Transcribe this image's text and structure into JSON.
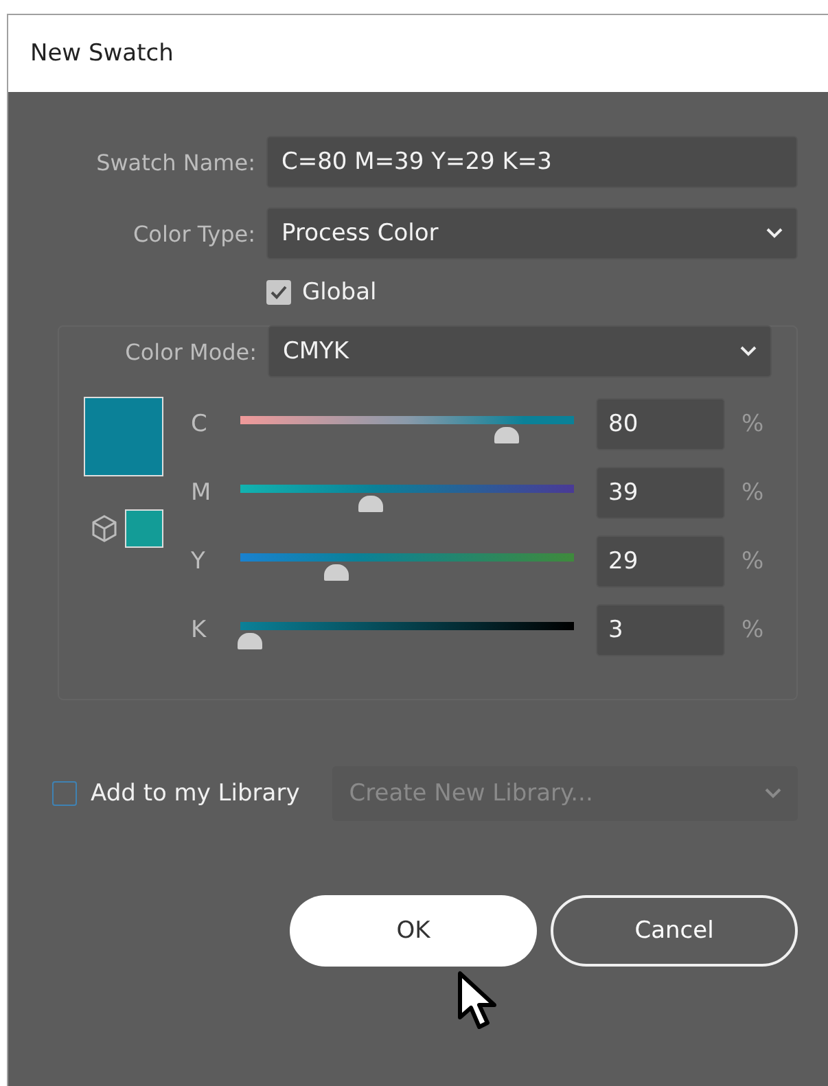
{
  "window": {
    "title": "New Swatch"
  },
  "swatch_name": {
    "label": "Swatch Name:",
    "value": "C=80 M=39 Y=29 K=3"
  },
  "color_type": {
    "label": "Color Type:",
    "value": "Process Color"
  },
  "global": {
    "label": "Global",
    "checked": true
  },
  "color_mode": {
    "label": "Color Mode:",
    "value": "CMYK"
  },
  "preview": {
    "swatch": {
      "color": "#0b8198"
    },
    "gamut_warning": {
      "color": "#139c97"
    }
  },
  "channels": [
    {
      "name": "C",
      "level": 0.8,
      "value": "80",
      "unit": "%"
    },
    {
      "name": "M",
      "level": 0.39,
      "value": "39",
      "unit": "%"
    },
    {
      "name": "Y",
      "level": 0.29,
      "value": "29",
      "unit": "%"
    },
    {
      "name": "K",
      "level": 0.03,
      "value": "3",
      "unit": "%"
    }
  ],
  "library": {
    "label": "Add to my Library",
    "checked": false,
    "dropdown": {
      "placeholder": "Create New Library...",
      "disabled": true
    }
  },
  "buttons": [
    {
      "label": "OK",
      "kind": "primary"
    },
    {
      "label": "Cancel",
      "kind": "secondary"
    }
  ]
}
